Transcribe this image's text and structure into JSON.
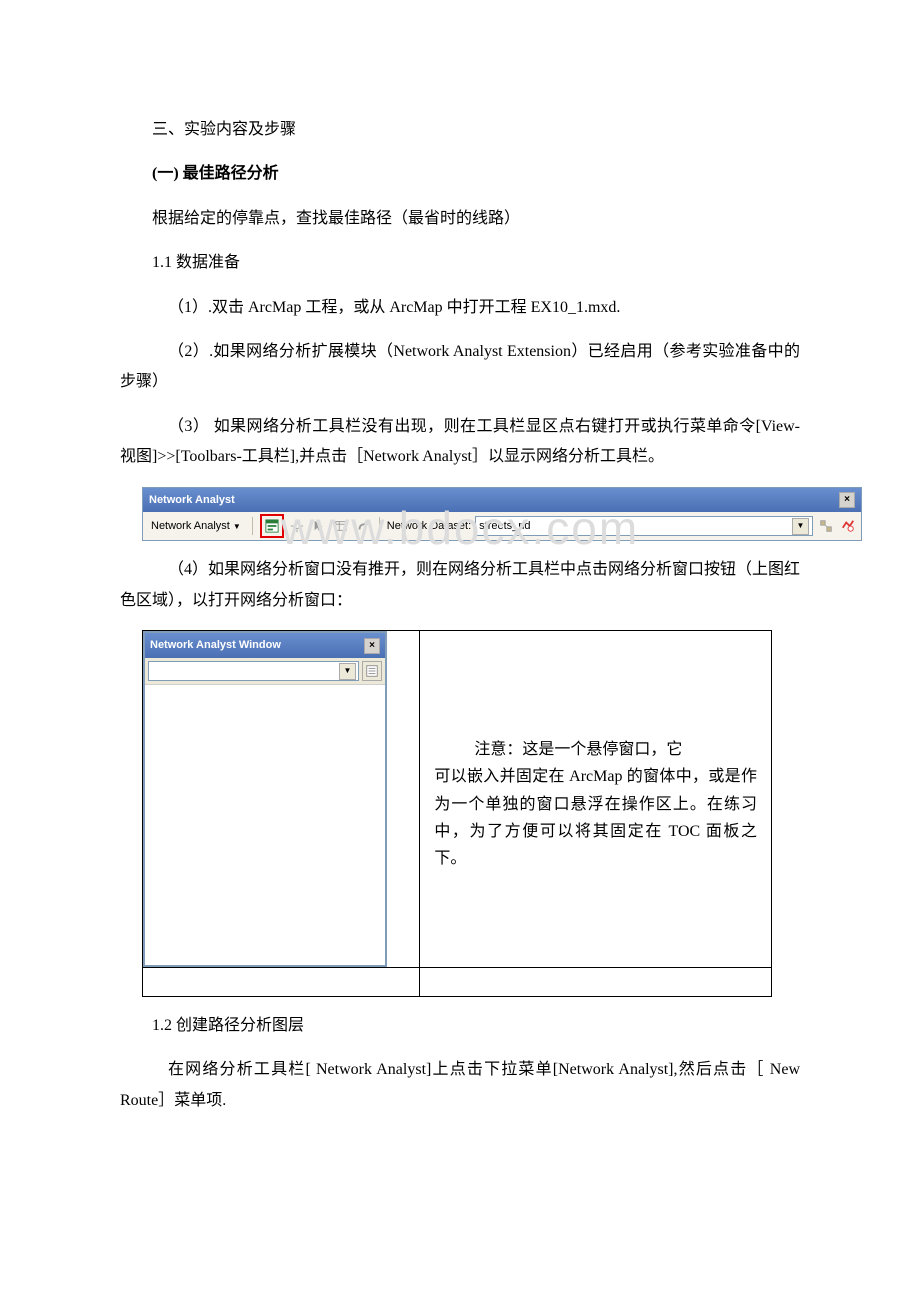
{
  "section_heading": "三、实验内容及步骤",
  "subsection_1": "(一) 最佳路径分析",
  "intro_1": "根据给定的停靠点，查找最佳路径（最省时的线路）",
  "h_11": "1.1 数据准备",
  "step_1": "（1）.双击 ArcMap 工程，或从 ArcMap 中打开工程 EX10_1.mxd.",
  "step_2": "（2）.如果网络分析扩展模块（Network Analyst Extension）已经启用（参考实验准备中的步骤）",
  "step_3": "（3） 如果网络分析工具栏没有出现，则在工具栏显区点右键打开或执行菜单命令[View-视图]>>[Toolbars-工具栏],并点击［Network Analyst］以显示网络分析工具栏。",
  "toolbar": {
    "title": "Network Analyst",
    "menu_label": "Network Analyst",
    "dataset_label": "Network Dataset:",
    "dataset_value": "streets_nd",
    "arrow": "▼"
  },
  "step_4": "（4）如果网络分析窗口没有推开，则在网络分析工具栏中点击网络分析窗口按钮（上图红色区域），以打开网络分析窗口：",
  "naw": {
    "title": "Network Analyst Window"
  },
  "note_first": "注意：这是一个悬停窗口，它",
  "note_rest": "可以嵌入并固定在 ArcMap 的窗体中，或是作为一个单独的窗口悬浮在操作区上。在练习中，为了方便可以将其固定在 TOC 面板之下。",
  "h_12": "1.2 创建路径分析图层",
  "p_12": "在网络分析工具栏[ Network Analyst]上点击下拉菜单[Network Analyst],然后点击［ New Route］菜单项.",
  "watermark": "www.bdocx.com"
}
